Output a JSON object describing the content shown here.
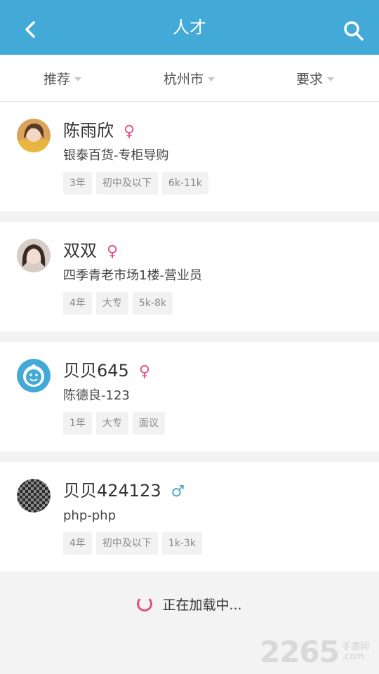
{
  "header": {
    "title": "人才",
    "back_icon": "chevron-left-icon",
    "search_icon": "search-icon"
  },
  "filters": [
    {
      "label": "推荐"
    },
    {
      "label": "杭州市"
    },
    {
      "label": "要求"
    }
  ],
  "candidates": [
    {
      "name": "陈雨欣",
      "gender": "♀",
      "job": "银泰百货-专柜导购",
      "tags": [
        "3年",
        "初中及以下",
        "6k-11k"
      ]
    },
    {
      "name": "双双",
      "gender": "♀",
      "job": "四季青老市场1楼-营业员",
      "tags": [
        "4年",
        "大专",
        "5k-8k"
      ]
    },
    {
      "name": "贝贝645",
      "gender": "♀",
      "job": "陈德良-123",
      "tags": [
        "1年",
        "大专",
        "面议"
      ]
    },
    {
      "name": "贝贝424123",
      "gender": "♂",
      "job": "php-php",
      "tags": [
        "4年",
        "初中及以下",
        "1k-3k"
      ]
    }
  ],
  "loading": {
    "text": "正在加载中..."
  },
  "watermark": {
    "number": "2265",
    "cn": "手游网",
    "suffix": ".com"
  },
  "colors": {
    "header": "#43a9d6",
    "female": "#e0508a",
    "male": "#43a9d6"
  }
}
